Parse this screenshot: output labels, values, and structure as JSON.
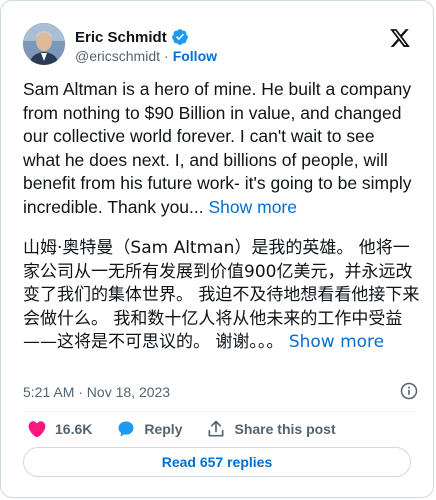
{
  "author": {
    "display_name": "Eric Schmidt",
    "handle": "@ericschmidt",
    "separator": "·",
    "follow_label": "Follow"
  },
  "tweet": {
    "text": "Sam Altman is a hero of mine.  He built a company from nothing to $90 Billion in value, and changed our collective world forever.  I can't wait to see what he does next.  I, and billions of people, will benefit from his future work- it's going to be simply incredible.  Thank you... ",
    "show_more_label": "Show more",
    "translation": "山姆·奥特曼（Sam Altman）是我的英雄。 他将一家公司从一无所有发展到价值900亿美元，并永远改变了我们的集体世界。 我迫不及待地想看看他接下来会做什么。 我和数十亿人将从他未来的工作中受益——这将是不可思议的。 谢谢。。。 ",
    "translation_show_more_label": "Show more",
    "timestamp": "5:21 AM · Nov 18, 2023"
  },
  "actions": {
    "likes": "16.6K",
    "reply_label": "Reply",
    "share_label": "Share this post"
  },
  "read_replies_label": "Read 657 replies",
  "icons": {
    "verified": "verified-badge-icon",
    "x_logo": "x-logo-icon",
    "info": "info-icon",
    "like": "heart-icon",
    "reply": "reply-bubble-icon",
    "share": "share-upload-icon"
  },
  "colors": {
    "accent": "#006fd6",
    "verified": "#1d9bf0",
    "like": "#f91880",
    "text": "#0f1419",
    "muted": "#536471"
  }
}
